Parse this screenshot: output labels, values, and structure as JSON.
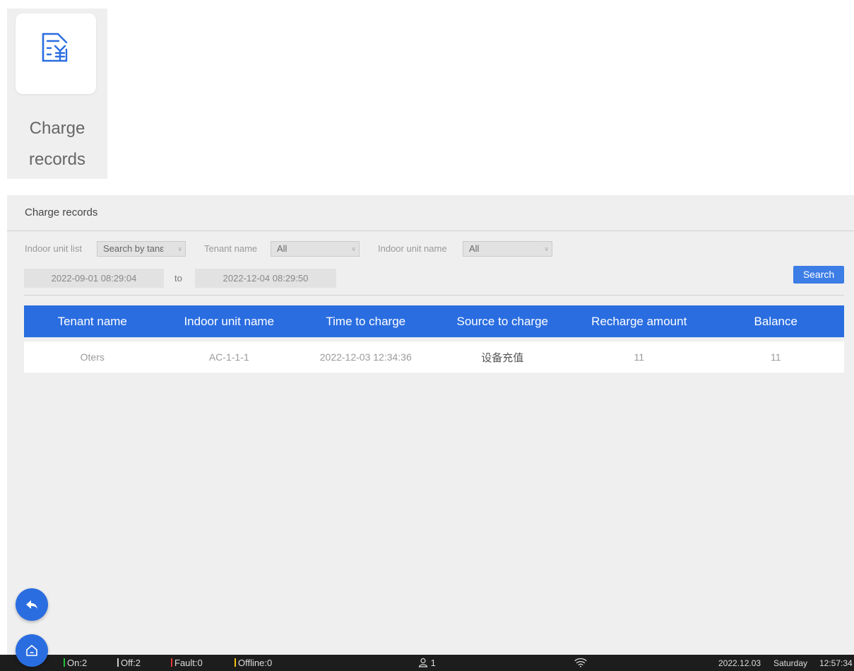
{
  "app_tile": {
    "label": "Charge records",
    "icon": "receipt-yen-icon"
  },
  "panel": {
    "title": "Charge records",
    "filters": {
      "indoor_unit_list_label": "Indoor unit list",
      "indoor_unit_list_value": "Search by tanε",
      "tenant_name_label": "Tenant name",
      "tenant_name_value": "All",
      "indoor_unit_name_label": "Indoor unit name",
      "indoor_unit_name_value": "All",
      "date_from": "2022-09-01 08:29:04",
      "to_label": "to",
      "date_to": "2022-12-04 08:29:50",
      "search_label": "Search"
    },
    "table": {
      "columns": [
        "Tenant name",
        "Indoor unit name",
        "Time to charge",
        "Source to charge",
        "Recharge amount",
        "Balance"
      ],
      "rows": [
        {
          "tenant": "Oters",
          "unit": "AC-1-1-1",
          "time": "2022-12-03 12:34:36",
          "source": "设备充值",
          "amount": "11",
          "balance": "11"
        }
      ]
    }
  },
  "status_bar": {
    "on": "On:2",
    "off": "Off:2",
    "fault": "Fault:0",
    "offline": "Offline:0",
    "users": "1",
    "date": "2022.12.03",
    "weekday": "Saturday",
    "time": "12:57:34",
    "colors": {
      "on": "#22c33a",
      "off": "#cccccc",
      "fault": "#e53935",
      "offline": "#f4c20d"
    }
  },
  "fab": {
    "back_icon": "reply-arrow-icon",
    "home_icon": "home-icon"
  }
}
